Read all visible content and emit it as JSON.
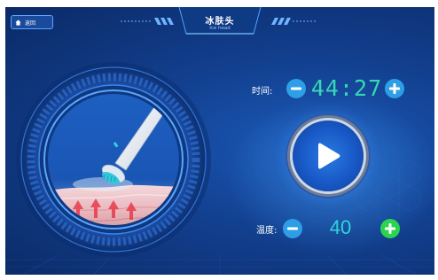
{
  "header": {
    "back_label": "返回",
    "title": "冰肤头",
    "subtitle": "Ice head"
  },
  "controls": {
    "time_label": "时间:",
    "time_value": "44:27",
    "temperature_label": "温度:",
    "temperature_value": "40"
  },
  "icons": {
    "back": "home-icon",
    "decrease": "minus-icon",
    "increase": "plus-icon",
    "play": "play-icon"
  },
  "colors": {
    "background": "#123f8e",
    "time_digits": "#35d8b2",
    "temperature_digits": "#2fd5d9",
    "minus_button": "#2e9fe6",
    "temperature_plus_button": "#2ad44f"
  }
}
